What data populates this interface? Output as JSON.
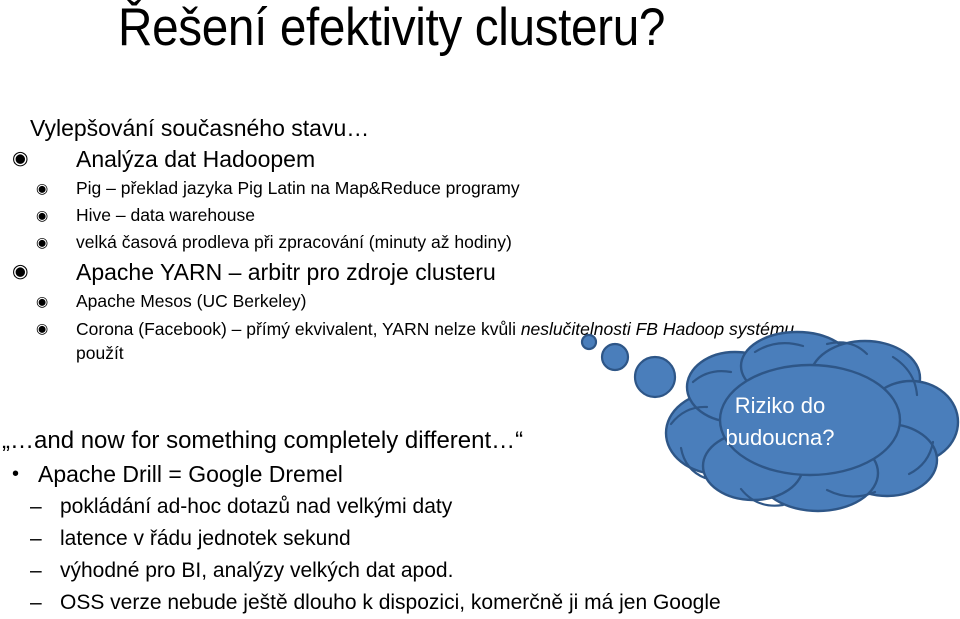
{
  "slide": {
    "title": "Řešení efektivity clusteru?",
    "background_color": "#ffffff",
    "text_color": "#000000"
  },
  "upper_section": {
    "heading": "Vylepšování současného stavu…",
    "bullets": [
      {
        "level": 1,
        "marker": "circled-dot-bullet",
        "marker_glyph": "◉",
        "text": "Analýza dat Hadoopem"
      },
      {
        "level": 2,
        "marker": "circled-dot-bullet",
        "marker_glyph": "◉",
        "text": "Pig – překlad jazyka Pig Latin na Map&Reduce programy"
      },
      {
        "level": 2,
        "marker": "circled-dot-bullet",
        "marker_glyph": "◉",
        "text": "Hive – data warehouse"
      },
      {
        "level": 2,
        "marker": "circled-dot-bullet",
        "marker_glyph": "◉",
        "text": "velká časová prodleva při zpracování (minuty až hodiny)"
      },
      {
        "level": 1,
        "marker": "circled-dot-bullet",
        "marker_glyph": "◉",
        "text": "Apache YARN – arbitr pro zdroje clusteru"
      },
      {
        "level": 2,
        "marker": "circled-dot-bullet",
        "marker_glyph": "◉",
        "text": "Apache Mesos (UC Berkeley)"
      }
    ],
    "corona_bullet": {
      "level": 2,
      "marker_glyph": "◉",
      "text_plain": "Corona (Facebook) – přímý ekvivalent, YARN nelze kvůli ",
      "text_italic": "neslučitelnosti FB Hadoop systému",
      "text_wrapped": "použít"
    }
  },
  "lower_section": {
    "quote": "„…and now for something completely different…“",
    "bullets": [
      {
        "level": 1,
        "marker": "round-bullet",
        "marker_glyph": "•",
        "text": "Apache Drill = Google Dremel"
      },
      {
        "level": 2,
        "marker": "dash-bullet",
        "marker_glyph": "–",
        "text": "pokládání ad-hoc dotazů nad velkými daty"
      },
      {
        "level": 2,
        "marker": "dash-bullet",
        "marker_glyph": "–",
        "text": "latence v řádu jednotek sekund"
      },
      {
        "level": 2,
        "marker": "dash-bullet",
        "marker_glyph": "–",
        "text": "výhodné pro BI, analýzy velkých dat apod."
      },
      {
        "level": 2,
        "marker": "dash-bullet",
        "marker_glyph": "–",
        "text": "OSS verze nebude ještě dlouho k dispozici, komerčně ji má jen Google"
      }
    ]
  },
  "thought_cloud": {
    "line1": "Riziko do",
    "line2": "budoucna?",
    "fill_color": "#4A7EBB",
    "stroke_color": "#2E5687",
    "text_color": "#FFFFFF"
  }
}
